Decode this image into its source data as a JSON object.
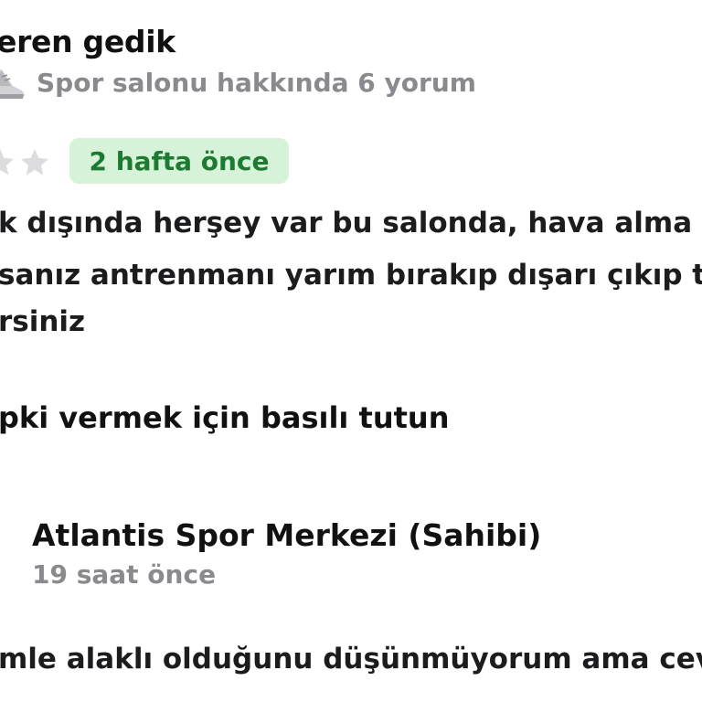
{
  "review": {
    "reviewer_name": "eren gedik",
    "reviewer_meta": "Spor salonu hakkında 6 yorum",
    "date": "2 hafta önce",
    "text_lines": [
      "k dışında herşey var bu salonda, hava alma",
      "sanız antrenmanı yarım bırakıp dışarı çıkıp t",
      "rsiniz"
    ],
    "icons": {
      "reviewer_badge": "sneaker-icon",
      "rating": "star-icon"
    }
  },
  "hint": "pki vermek için basılı tutun",
  "owner_response": {
    "name": "Atlantis Spor Merkezi (Sahibi)",
    "time": "19 saat önce",
    "text": "mle alaklı olduğunu düşünmüyorum ama cev",
    "icons": {
      "verified": "verified-badge-icon"
    }
  },
  "colors": {
    "badge_bg": "#d6f3d9",
    "badge_text": "#1d7a30",
    "meta_text": "#8a8a8e",
    "star_empty": "#dcdcdf",
    "verified_blue": "#1a73e8"
  }
}
